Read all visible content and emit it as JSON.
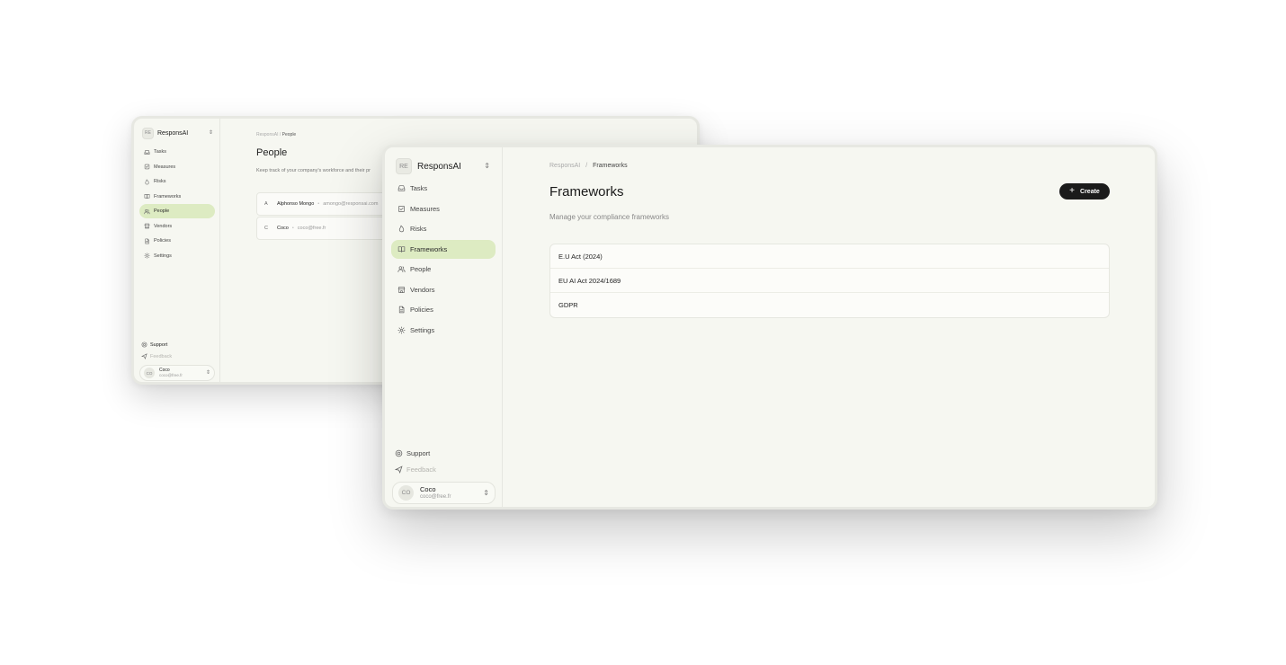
{
  "back_window": {
    "org": {
      "badge": "RE",
      "name": "ResponsAI"
    },
    "nav": [
      {
        "label": "Tasks",
        "icon": "inbox-icon",
        "active": false
      },
      {
        "label": "Measures",
        "icon": "checkbox-icon",
        "active": false
      },
      {
        "label": "Risks",
        "icon": "flame-icon",
        "active": false
      },
      {
        "label": "Frameworks",
        "icon": "book-icon",
        "active": false
      },
      {
        "label": "People",
        "icon": "users-icon",
        "active": true
      },
      {
        "label": "Vendors",
        "icon": "store-icon",
        "active": false
      },
      {
        "label": "Policies",
        "icon": "document-icon",
        "active": false
      },
      {
        "label": "Settings",
        "icon": "gear-icon",
        "active": false
      }
    ],
    "support_label": "Support",
    "feedback_label": "Feedback",
    "user": {
      "initials": "CO",
      "name": "Coco",
      "email": "coco@free.fr"
    },
    "breadcrumb": {
      "root": "ResponsAI",
      "separator": "/",
      "current": "People"
    },
    "title": "People",
    "subtitle": "Keep track of your company's workforce and their pr",
    "people": [
      {
        "letter": "A",
        "name": "Alphonso Mongo",
        "email": "amongo@responsai.com"
      },
      {
        "letter": "C",
        "name": "Coco",
        "email": "coco@free.fr"
      }
    ]
  },
  "front_window": {
    "org": {
      "badge": "RE",
      "name": "ResponsAI"
    },
    "nav": [
      {
        "label": "Tasks",
        "icon": "inbox-icon",
        "active": false
      },
      {
        "label": "Measures",
        "icon": "checkbox-icon",
        "active": false
      },
      {
        "label": "Risks",
        "icon": "flame-icon",
        "active": false
      },
      {
        "label": "Frameworks",
        "icon": "book-icon",
        "active": true
      },
      {
        "label": "People",
        "icon": "users-icon",
        "active": false
      },
      {
        "label": "Vendors",
        "icon": "store-icon",
        "active": false
      },
      {
        "label": "Policies",
        "icon": "document-icon",
        "active": false
      },
      {
        "label": "Settings",
        "icon": "gear-icon",
        "active": false
      }
    ],
    "support_label": "Support",
    "feedback_label": "Feedback",
    "user": {
      "initials": "CO",
      "name": "Coco",
      "email": "coco@free.fr"
    },
    "breadcrumb": {
      "root": "ResponsAI",
      "separator": "/",
      "current": "Frameworks"
    },
    "title": "Frameworks",
    "subtitle": "Manage your compliance frameworks",
    "create_label": "Create",
    "frameworks": [
      "E.U Act (2024)",
      "EU AI Act 2024/1689",
      "GDPR"
    ]
  },
  "colors": {
    "app_background": "#f6f7f1",
    "active_nav": "#ddebc2",
    "primary_button": "#1b1b1b"
  }
}
